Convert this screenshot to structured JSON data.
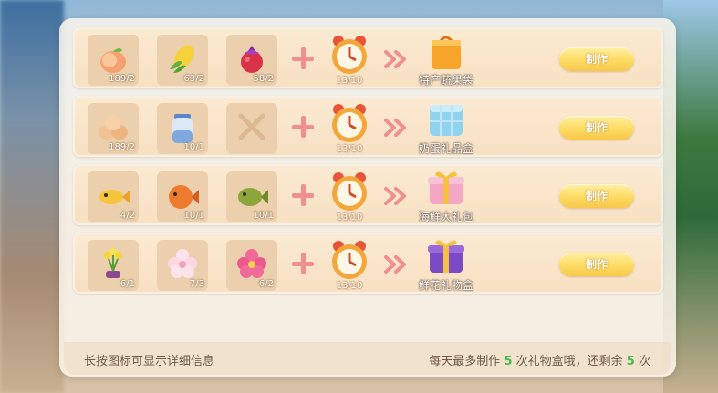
{
  "recipes": [
    {
      "ingredients": [
        {
          "icon": "peach-icon",
          "qty": "189/2"
        },
        {
          "icon": "corn-icon",
          "qty": "63/2"
        },
        {
          "icon": "red-fruit-icon",
          "qty": "58/2"
        }
      ],
      "time_qty": "13/10",
      "output": {
        "icon": "orange-bag-icon",
        "name": "特产蔬果袋"
      },
      "button": "制作"
    },
    {
      "ingredients": [
        {
          "icon": "eggs-icon",
          "qty": "189/2"
        },
        {
          "icon": "milk-jar-icon",
          "qty": "10/1"
        },
        {
          "icon": "empty-slot-icon",
          "qty": ""
        }
      ],
      "time_qty": "13/10",
      "output": {
        "icon": "ice-box-icon",
        "name": "奶蛋礼品盒"
      },
      "button": "制作"
    },
    {
      "ingredients": [
        {
          "icon": "yellow-fish-icon",
          "qty": "4/2"
        },
        {
          "icon": "orange-fish-icon",
          "qty": "10/1"
        },
        {
          "icon": "green-fish-icon",
          "qty": "10/1"
        }
      ],
      "time_qty": "13/10",
      "output": {
        "icon": "gift-box-pink-icon",
        "name": "海鲜大礼包"
      },
      "button": "制作"
    },
    {
      "ingredients": [
        {
          "icon": "yellow-flower-icon",
          "qty": "6/1"
        },
        {
          "icon": "white-flower-icon",
          "qty": "7/3"
        },
        {
          "icon": "pink-flower-icon",
          "qty": "6/2"
        }
      ],
      "time_qty": "13/10",
      "output": {
        "icon": "purple-gift-box-icon",
        "name": "鲜花礼物盒"
      },
      "button": "制作"
    }
  ],
  "footer": {
    "hint": "长按图标可显示详细信息",
    "limit_prefix": "每天最多制作",
    "limit_count": "5",
    "limit_middle": "次礼物盒哦，还剩余",
    "remaining": "5",
    "limit_suffix": "次"
  },
  "colors": {
    "button_yellow": "#fddb63",
    "plus_pink": "#ef8f90",
    "highlight_green": "#48b84f",
    "row_bg": "#fbead2"
  }
}
